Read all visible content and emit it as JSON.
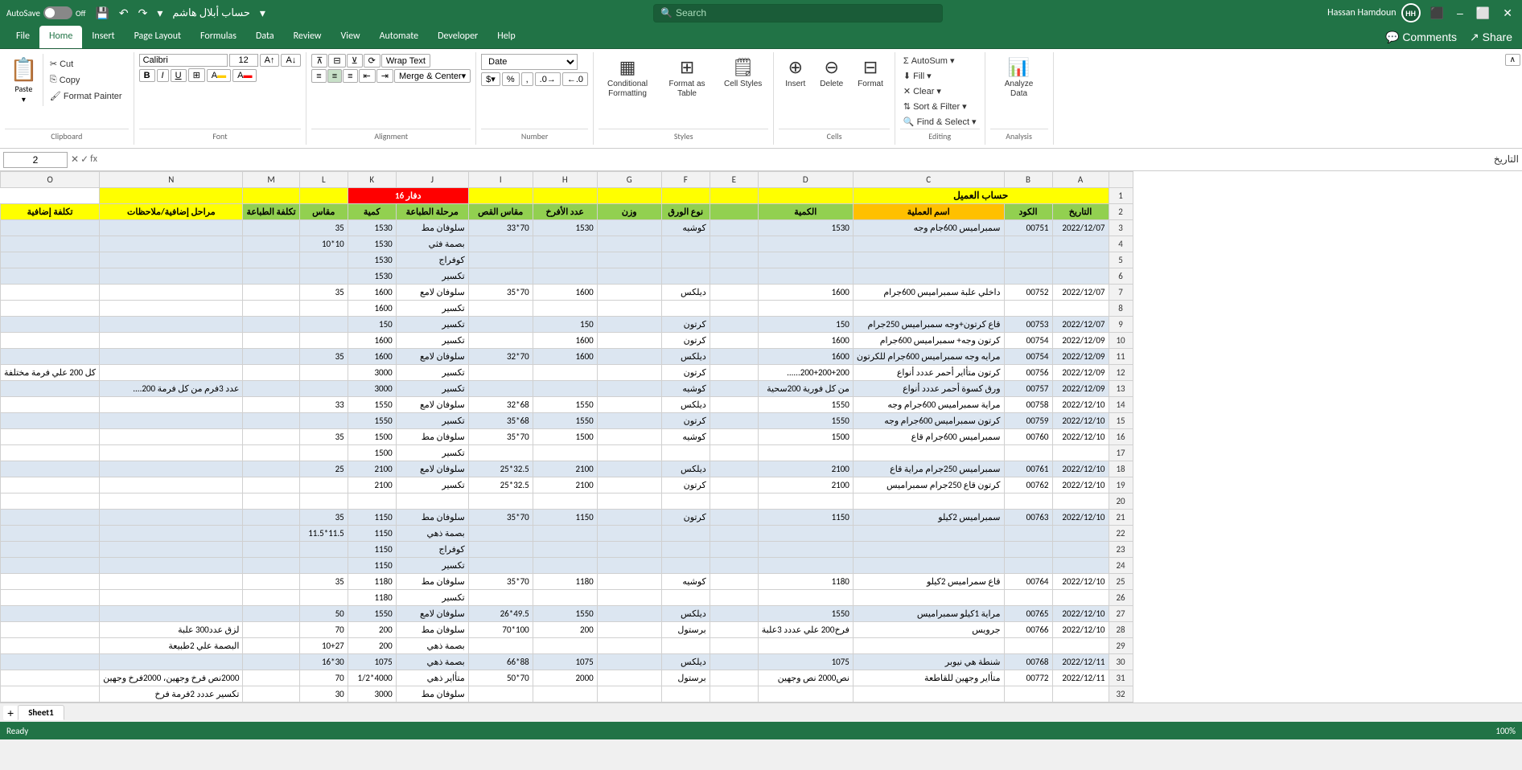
{
  "titleBar": {
    "autosave": "AutoSave",
    "autosave_state": "Off",
    "filename": "حساب أبلال هاشم",
    "username": "Hassan Hamdoun",
    "avatar_initials": "HH",
    "search_placeholder": "Search",
    "win_buttons": [
      "–",
      "⬜",
      "✕"
    ]
  },
  "tabs": [
    "File",
    "Home",
    "Insert",
    "Page Layout",
    "Formulas",
    "Data",
    "Review",
    "View",
    "Automate",
    "Developer",
    "Help"
  ],
  "active_tab": "Home",
  "ribbon": {
    "clipboard": {
      "label": "Clipboard",
      "paste_label": "Paste",
      "cut_label": "Cut",
      "copy_label": "Copy",
      "format_painter_label": "Format Painter"
    },
    "font": {
      "label": "Font",
      "font_name": "Calibri",
      "font_size": "12",
      "bold": "B",
      "italic": "I",
      "underline": "U"
    },
    "alignment": {
      "label": "Alignment",
      "wrap_text": "Wrap Text",
      "merge_center": "Merge & Center"
    },
    "number": {
      "label": "Number",
      "format": "Date"
    },
    "styles": {
      "label": "Styles",
      "conditional_formatting": "Conditional Formatting",
      "format_as_table": "Format as Table",
      "cell_styles": "Cell Styles"
    },
    "cells": {
      "label": "Cells",
      "insert": "Insert",
      "delete": "Delete",
      "format": "Format"
    },
    "editing": {
      "label": "Editing",
      "autosum": "AutoSum",
      "fill": "Fill",
      "clear": "Clear",
      "sort_filter": "Sort & Filter",
      "find_select": "Find & Select"
    },
    "analysis": {
      "label": "Analysis",
      "analyze_data": "Analyze Data"
    }
  },
  "formulaBar": {
    "cell_ref": "2",
    "rtl_label": "التاريخ"
  },
  "sheet": {
    "headers": [
      "A",
      "B",
      "C",
      "D",
      "E",
      "F",
      "G",
      "H",
      "I",
      "J",
      "K",
      "L",
      "M",
      "N",
      "O"
    ],
    "row1": {
      "account_label": "حساب العميل",
      "daftar_label": "دفار 16"
    },
    "col_headers_row2": [
      "التاريخ",
      "الكود",
      "اسم العملية",
      "الكمية",
      "",
      "نوع الورق",
      "وزن",
      "عدد الأفرخ",
      "مقاس القص",
      "مرحلة الطباعة",
      "كمية",
      "مقاس",
      "تكلفة الطباعة",
      "مراحل إضافية/ملاحظات",
      "تكلفة إضافية"
    ],
    "rows": [
      {
        "num": 3,
        "a": "2022/12/07",
        "b": "00751",
        "c": "سمبراميس 600جام وجه",
        "d": "1530",
        "e": "",
        "f": "كوشيه",
        "g": "",
        "h": "1530",
        "i": "70*33",
        "j": "سلوفان مط",
        "k": "1530",
        "l": "35",
        "m": "",
        "n": "",
        "o": "",
        "class": "cell-blue-light"
      },
      {
        "num": 4,
        "a": "",
        "b": "",
        "c": "",
        "d": "",
        "e": "",
        "f": "",
        "g": "",
        "h": "",
        "i": "",
        "j": "بصمة فثي",
        "k": "1530",
        "l": "10*10",
        "m": "",
        "n": "",
        "o": "",
        "class": "cell-blue-light"
      },
      {
        "num": 5,
        "a": "",
        "b": "",
        "c": "",
        "d": "",
        "e": "",
        "f": "",
        "g": "",
        "h": "",
        "i": "",
        "j": "كوفراج",
        "k": "1530",
        "l": "",
        "m": "",
        "n": "",
        "o": "",
        "class": "cell-blue-light"
      },
      {
        "num": 6,
        "a": "",
        "b": "",
        "c": "",
        "d": "",
        "e": "",
        "f": "",
        "g": "",
        "h": "",
        "i": "",
        "j": "تكسير",
        "k": "1530",
        "l": "",
        "m": "",
        "n": "",
        "o": "",
        "class": "cell-blue-light"
      },
      {
        "num": 7,
        "a": "2022/12/07",
        "b": "00752",
        "c": "داخلي علبة سمبراميس 600جرام",
        "d": "1600",
        "e": "",
        "f": "ديلكس",
        "g": "",
        "h": "1600",
        "i": "70*35",
        "j": "سلوفان لامع",
        "k": "1600",
        "l": "35",
        "m": "",
        "n": "",
        "o": "",
        "class": ""
      },
      {
        "num": 8,
        "a": "",
        "b": "",
        "c": "",
        "d": "",
        "e": "",
        "f": "",
        "g": "",
        "h": "",
        "i": "",
        "j": "تكسير",
        "k": "1600",
        "l": "",
        "m": "",
        "n": "",
        "o": "",
        "class": ""
      },
      {
        "num": 9,
        "a": "2022/12/07",
        "b": "00753",
        "c": "قاع كرتون+وجه سمبراميس 250جرام",
        "d": "150",
        "e": "",
        "f": "كرتون",
        "g": "",
        "h": "150",
        "i": "",
        "j": "تكسير",
        "k": "150",
        "l": "",
        "m": "",
        "n": "",
        "o": "",
        "class": "cell-blue-light"
      },
      {
        "num": 10,
        "a": "2022/12/09",
        "b": "00754",
        "c": "كرتون وجه+ سمبراميس 600جرام",
        "d": "1600",
        "e": "",
        "f": "كرتون",
        "g": "",
        "h": "1600",
        "i": "",
        "j": "تكسير",
        "k": "1600",
        "l": "",
        "m": "",
        "n": "",
        "o": "",
        "class": ""
      },
      {
        "num": 11,
        "a": "2022/12/09",
        "b": "00754",
        "c": "مرايه وجه سمبراميس 600جرام للكرتون",
        "d": "1600",
        "e": "",
        "f": "ديلكس",
        "g": "",
        "h": "1600",
        "i": "70*32",
        "j": "سلوفان لامع",
        "k": "1600",
        "l": "35",
        "m": "",
        "n": "",
        "o": "",
        "class": "cell-blue-light"
      },
      {
        "num": 12,
        "a": "2022/12/09",
        "b": "00756",
        "c": "كرتون متأاير أحمر عددد أنواع",
        "d": "200+200+200......",
        "e": "",
        "f": "كرتون",
        "g": "",
        "h": "",
        "i": "",
        "j": "تكسير",
        "k": "3000",
        "l": "",
        "m": "",
        "n": "",
        "o": "كل 200 علي فرمة مختلفة",
        "class": ""
      },
      {
        "num": 13,
        "a": "2022/12/09",
        "b": "00757",
        "c": "ورق كسوة أحمر عددد أنواع",
        "d": "من كل فورية 200سحية",
        "e": "",
        "f": "كوشيه",
        "g": "",
        "h": "",
        "i": "",
        "j": "تكسير",
        "k": "3000",
        "l": "",
        "m": "",
        "n": "عدد 3فرم من كل فرمة 200....",
        "o": "",
        "class": "cell-blue-light"
      },
      {
        "num": 14,
        "a": "2022/12/10",
        "b": "00758",
        "c": "مراية سمبراميس 600جرام وجه",
        "d": "1550",
        "e": "",
        "f": "ديلكس",
        "g": "",
        "h": "1550",
        "i": "68*32",
        "j": "سلوفان لامع",
        "k": "1550",
        "l": "33",
        "m": "",
        "n": "",
        "o": "",
        "class": ""
      },
      {
        "num": 15,
        "a": "2022/12/10",
        "b": "00759",
        "c": "كرتون سمبراميس 600جرام وجه",
        "d": "1550",
        "e": "",
        "f": "كرتون",
        "g": "",
        "h": "1550",
        "i": "68*35",
        "j": "تكسير",
        "k": "1550",
        "l": "",
        "m": "",
        "n": "",
        "o": "",
        "class": "cell-blue-light"
      },
      {
        "num": 16,
        "a": "2022/12/10",
        "b": "00760",
        "c": "سمبراميس 600جرام قاع",
        "d": "1500",
        "e": "",
        "f": "كوشيه",
        "g": "",
        "h": "1500",
        "i": "70*35",
        "j": "سلوفان مط",
        "k": "1500",
        "l": "35",
        "m": "",
        "n": "",
        "o": "",
        "class": ""
      },
      {
        "num": 17,
        "a": "",
        "b": "",
        "c": "",
        "d": "",
        "e": "",
        "f": "",
        "g": "",
        "h": "",
        "i": "",
        "j": "تكسير",
        "k": "1500",
        "l": "",
        "m": "",
        "n": "",
        "o": "",
        "class": ""
      },
      {
        "num": 18,
        "a": "2022/12/10",
        "b": "00761",
        "c": "سمبراميس 250جرام مراية قاع",
        "d": "2100",
        "e": "",
        "f": "ديلكس",
        "g": "",
        "h": "2100",
        "i": "32.5*25",
        "j": "سلوفان لامع",
        "k": "2100",
        "l": "25",
        "m": "",
        "n": "",
        "o": "",
        "class": "cell-blue-light"
      },
      {
        "num": 19,
        "a": "2022/12/10",
        "b": "00762",
        "c": "كرتون قاع 250جرام سمبراميس",
        "d": "2100",
        "e": "",
        "f": "كرتون",
        "g": "",
        "h": "2100",
        "i": "32.5*25",
        "j": "تكسير",
        "k": "2100",
        "l": "",
        "m": "",
        "n": "",
        "o": "",
        "class": ""
      },
      {
        "num": 20,
        "a": "",
        "b": "",
        "c": "",
        "d": "",
        "e": "",
        "f": "",
        "g": "",
        "h": "",
        "i": "",
        "j": "",
        "k": "",
        "l": "",
        "m": "",
        "n": "",
        "o": "",
        "class": ""
      },
      {
        "num": 21,
        "a": "2022/12/10",
        "b": "00763",
        "c": "سمبراميس 2كيلو",
        "d": "1150",
        "e": "",
        "f": "كرتون",
        "g": "",
        "h": "1150",
        "i": "70*35",
        "j": "سلوفان مط",
        "k": "1150",
        "l": "35",
        "m": "",
        "n": "",
        "o": "",
        "class": "cell-blue-light"
      },
      {
        "num": 22,
        "a": "",
        "b": "",
        "c": "",
        "d": "",
        "e": "",
        "f": "",
        "g": "",
        "h": "",
        "i": "",
        "j": "بصمة ذهي",
        "k": "1150",
        "l": "11.5*11.5",
        "m": "",
        "n": "",
        "o": "",
        "class": "cell-blue-light"
      },
      {
        "num": 23,
        "a": "",
        "b": "",
        "c": "",
        "d": "",
        "e": "",
        "f": "",
        "g": "",
        "h": "",
        "i": "",
        "j": "كوفراج",
        "k": "1150",
        "l": "",
        "m": "",
        "n": "",
        "o": "",
        "class": "cell-blue-light"
      },
      {
        "num": 24,
        "a": "",
        "b": "",
        "c": "",
        "d": "",
        "e": "",
        "f": "",
        "g": "",
        "h": "",
        "i": "",
        "j": "تكسير",
        "k": "1150",
        "l": "",
        "m": "",
        "n": "",
        "o": "",
        "class": "cell-blue-light"
      },
      {
        "num": 25,
        "a": "2022/12/10",
        "b": "00764",
        "c": "قاع سمراميس 2كيلو",
        "d": "1180",
        "e": "",
        "f": "كوشيه",
        "g": "",
        "h": "1180",
        "i": "70*35",
        "j": "سلوفان مط",
        "k": "1180",
        "l": "35",
        "m": "",
        "n": "",
        "o": "",
        "class": ""
      },
      {
        "num": 26,
        "a": "",
        "b": "",
        "c": "",
        "d": "",
        "e": "",
        "f": "",
        "g": "",
        "h": "",
        "i": "",
        "j": "تكسير",
        "k": "1180",
        "l": "",
        "m": "",
        "n": "",
        "o": "",
        "class": ""
      },
      {
        "num": 27,
        "a": "2022/12/10",
        "b": "00765",
        "c": "مراية 1كيلو سمبراميس",
        "d": "1550",
        "e": "",
        "f": "ديلكس",
        "g": "",
        "h": "1550",
        "i": "49.5*26",
        "j": "سلوفان لامع",
        "k": "1550",
        "l": "50",
        "m": "",
        "n": "",
        "o": "",
        "class": "cell-blue-light"
      },
      {
        "num": 28,
        "a": "2022/12/10",
        "b": "00766",
        "c": "جرويس",
        "d": "فرخ200 علي عددد 3علبة",
        "e": "",
        "f": "برستول",
        "g": "",
        "h": "200",
        "i": "100*70",
        "j": "سلوفان مط",
        "k": "200",
        "l": "70",
        "m": "",
        "n": "لزق عدد300 علبة",
        "o": "",
        "class": ""
      },
      {
        "num": 29,
        "a": "",
        "b": "",
        "c": "",
        "d": "",
        "e": "",
        "f": "",
        "g": "",
        "h": "",
        "i": "",
        "j": "بصمة ذهي",
        "k": "200",
        "l": "10+27",
        "m": "",
        "n": "البصمة علي 2طبيعة",
        "o": "",
        "class": ""
      },
      {
        "num": 30,
        "a": "2022/12/11",
        "b": "00768",
        "c": "شنطة هي نيوبر",
        "d": "1075",
        "e": "",
        "f": "ديلكس",
        "g": "",
        "h": "1075",
        "i": "88*66",
        "j": "بصمة ذهي",
        "k": "1075",
        "l": "30*16",
        "m": "",
        "n": "",
        "o": "",
        "class": "cell-blue-light"
      },
      {
        "num": 31,
        "a": "2022/12/11",
        "b": "00772",
        "c": "متأاير وجهين للقاطعة",
        "d": "نص2000 نص وجهين",
        "e": "",
        "f": "برستول",
        "g": "",
        "h": "2000",
        "i": "70*50",
        "j": "متأاير ذهي",
        "k": "4000*1/2",
        "l": "70",
        "m": "",
        "n": "2000نص فرخ وجهين، 2000فرخ وجهين",
        "o": "",
        "class": ""
      },
      {
        "num": 32,
        "a": "",
        "b": "",
        "c": "",
        "d": "",
        "e": "",
        "f": "",
        "g": "",
        "h": "",
        "i": "",
        "j": "سلوفان مط",
        "k": "3000",
        "l": "30",
        "m": "",
        "n": "تكسير عددد 2فرمة فرخ",
        "o": "",
        "class": ""
      }
    ]
  },
  "sheetTabs": [
    "Sheet1"
  ],
  "statusBar": {
    "left": "Ready",
    "zoom": "100%"
  }
}
